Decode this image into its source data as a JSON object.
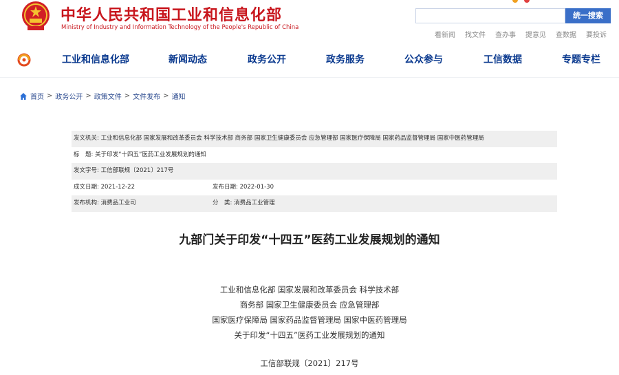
{
  "header": {
    "title": "中华人民共和国工业和信息化部",
    "subtitle": "Ministry of Industry and Information Technology of the People's Republic of China",
    "search_placeholder": "",
    "search_button": "统一搜索",
    "quick_links": [
      "看新闻",
      "找文件",
      "查办事",
      "提意见",
      "查数据",
      "要投诉"
    ],
    "brand_color": "#c8161d",
    "accent_color": "#3a6fc8"
  },
  "nav": {
    "items": [
      "工业和信息化部",
      "新闻动态",
      "政务公开",
      "政务服务",
      "公众参与",
      "工信数据",
      "专题专栏"
    ]
  },
  "breadcrumb": {
    "items": [
      "首页",
      "政务公开",
      "政策文件",
      "文件发布",
      "通知"
    ],
    "separator": ">"
  },
  "meta": {
    "issuer_label": "发文机关:",
    "issuer_value": "工业和信息化部 国家发展和改革委员会 科学技术部 商务部 国家卫生健康委员会 应急管理部 国家医疗保障局 国家药品监督管理局 国家中医药管理局",
    "title_label": "标　题:",
    "title_value": "关于印发“十四五”医药工业发展规划的通知",
    "docno_label": "发文字号:",
    "docno_value": "工信部联规〔2021〕217号",
    "created_label": "成文日期:",
    "created_value": "2021-12-22",
    "published_label": "发布日期:",
    "published_value": "2022-01-30",
    "agency_label": "发布机构:",
    "agency_value": "消费品工业司",
    "category_label": "分　类:",
    "category_value": "消费品工业管理"
  },
  "document": {
    "title": "九部门关于印发“十四五”医药工业发展规划的通知",
    "lines": [
      "工业和信息化部 国家发展和改革委员会 科学技术部",
      "商务部 国家卫生健康委员会 应急管理部",
      "国家医疗保障局 国家药品监督管理局 国家中医药管理局",
      "关于印发“十四五”医药工业发展规划的通知"
    ],
    "doc_number": "工信部联规〔2021〕217号"
  }
}
